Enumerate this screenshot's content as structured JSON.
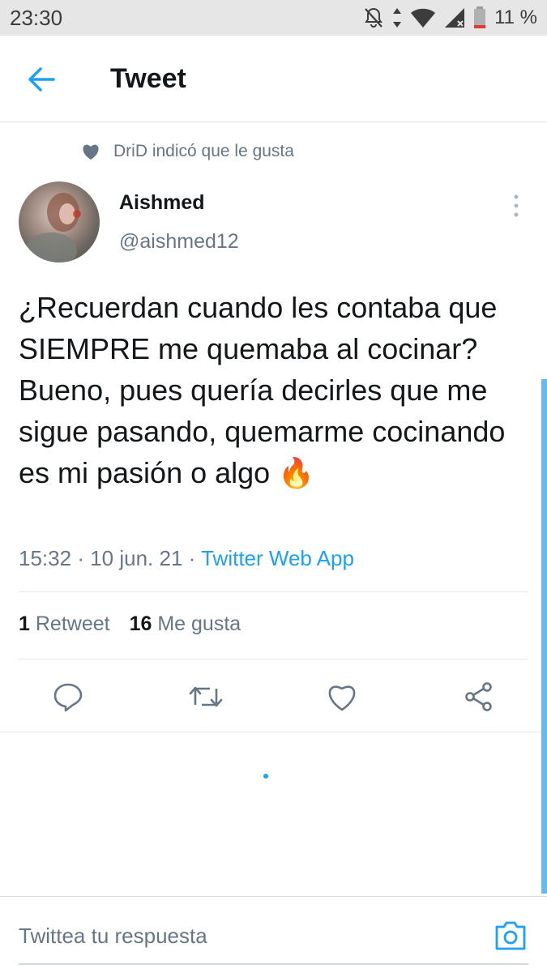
{
  "status_bar": {
    "time": "23:30",
    "battery": "11 %",
    "icons": [
      "notifications-off-icon",
      "data-arrows-icon",
      "wifi-icon",
      "signal-icon",
      "battery-icon"
    ]
  },
  "header": {
    "title": "Tweet",
    "back_icon": "back-arrow-icon"
  },
  "social_context": {
    "icon": "heart-filled-icon",
    "text": "DriD indicó que le gusta"
  },
  "tweet": {
    "display_name": "Aishmed",
    "handle": "@aishmed12",
    "text": "¿Recuerdan cuando les contaba que SIEMPRE me quemaba al cocinar? Bueno, pues quería decirles que me sigue pasando, quemarme cocinando es mi pasión o algo 🔥",
    "time": "15:32",
    "date": "10 jun. 21",
    "separator": "·",
    "source": "Twitter Web App",
    "retweet_count": "1",
    "retweet_label": "Retweet",
    "like_count": "16",
    "like_label": "Me gusta"
  },
  "actions": [
    {
      "name": "reply-button",
      "icon": "reply-icon"
    },
    {
      "name": "retweet-button",
      "icon": "retweet-icon"
    },
    {
      "name": "like-button",
      "icon": "heart-outline-icon"
    },
    {
      "name": "share-button",
      "icon": "share-icon"
    }
  ],
  "reply_box": {
    "placeholder": "Twittea tu respuesta",
    "icon": "camera-icon"
  },
  "colors": {
    "accent": "#1da1f2",
    "secondary_text": "#657786",
    "primary_text": "#14171a",
    "divider": "#e1e8ed"
  }
}
